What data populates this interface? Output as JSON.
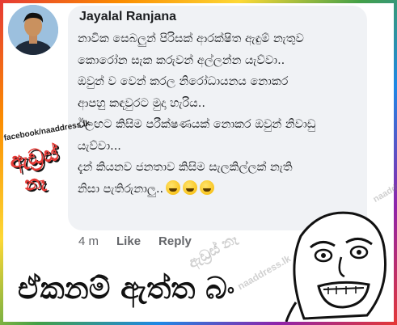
{
  "comment": {
    "author": "Jayalal Ranjana",
    "lines": [
      "නාවික සෙබලුන් පිරිසක් ආරක්ෂිත ඇඳුම් නැතුව",
      "කොරෝන සැක කරුවන් අල්ලන්න  යැව්වා..",
      "ඔවුන් ව  වෙන් කරල නිරෝධායනය නොකර",
      "ආපහු කඳවුරට මුදා හැරිය..",
      "ඊලඟට කිසිම පරීක්ෂණයක් නොකර ඔවුන් නිවාඩු",
      "යැව්වා...",
      "දැන් කියනව ජනතාව කිසිම සැලකිල්ලක් නැති",
      "නිසා පැතිරුනාලු.."
    ],
    "emoji_count": 3,
    "emoji": "grinning-sweat-emoji"
  },
  "actions": {
    "time": "4 m",
    "like": "Like",
    "reply": "Reply"
  },
  "brand": {
    "url": "facebook/naaddress.lk",
    "logo_line1": "ඇඩ්‍රස්",
    "logo_line2": "නෑ"
  },
  "caption": "ඒකනම් ඇත්ත බං",
  "watermarks": [
    "ඇඩ්‍රස් නෑ",
    "naaddress.lk",
    "naaddress.lk"
  ],
  "colors": {
    "bubble": "#f0f2f5",
    "logo_red": "#e53935",
    "action_grey": "#65676b"
  }
}
